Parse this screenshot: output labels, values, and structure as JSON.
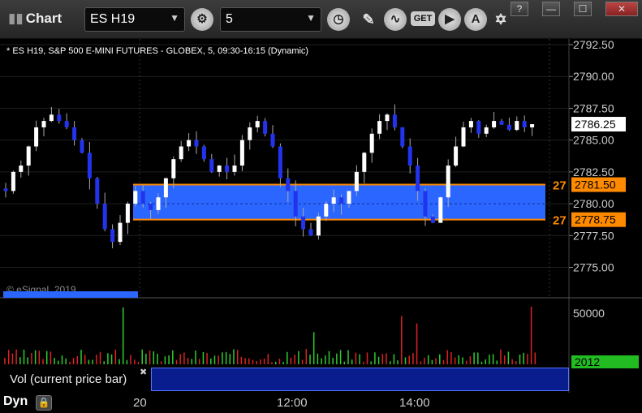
{
  "app": {
    "title": "Chart"
  },
  "toolbar": {
    "symbol": "ES H19",
    "interval": "5",
    "icons": [
      "gear-icon",
      "clock-icon",
      "pencil-icon",
      "indicator-icon",
      "get-icon",
      "play-icon",
      "alert-icon",
      "link-icon"
    ],
    "get_label": "GET",
    "alert_letter": "A",
    "window_buttons": [
      "?",
      "—",
      "☐",
      "✕"
    ]
  },
  "chart": {
    "header": "* ES H19, S&P 500 E-MINI FUTURES - GLOBEX, 5, 09:30-16:15 (Dynamic)",
    "watermark": "© eSignal, 2019",
    "current_price": "2786.25",
    "zone_upper": "2781.50",
    "zone_lower": "2778.75",
    "zone_prefix": "27",
    "volume_axis": "50000",
    "volume_current": "2012",
    "volume_label": "Vol (current price bar)",
    "volume_close": "✖",
    "dyn_label": "Dyn",
    "lock_icon": "lock-icon",
    "colors": {
      "up": "#ffffff",
      "down": "#2233ee",
      "zone": "#2a66ff",
      "zone_line": "#ff8a00",
      "vol_up": "#2ecc2e",
      "vol_down": "#dd2222",
      "price_tag": "#ffffff",
      "vol_tag": "#22bb22"
    }
  },
  "chart_data": {
    "type": "candlestick",
    "y_ticks": [
      "2792.50",
      "2790.00",
      "2787.50",
      "2785.00",
      "2782.50",
      "2780.00",
      "2777.50",
      "2775.00"
    ],
    "ylim": [
      2772.5,
      2793.5
    ],
    "x_ticks": [
      "20",
      "12:00",
      "14:00"
    ],
    "bars_approx": 80,
    "last_price": 2786.25,
    "last_volume": 2012
  }
}
